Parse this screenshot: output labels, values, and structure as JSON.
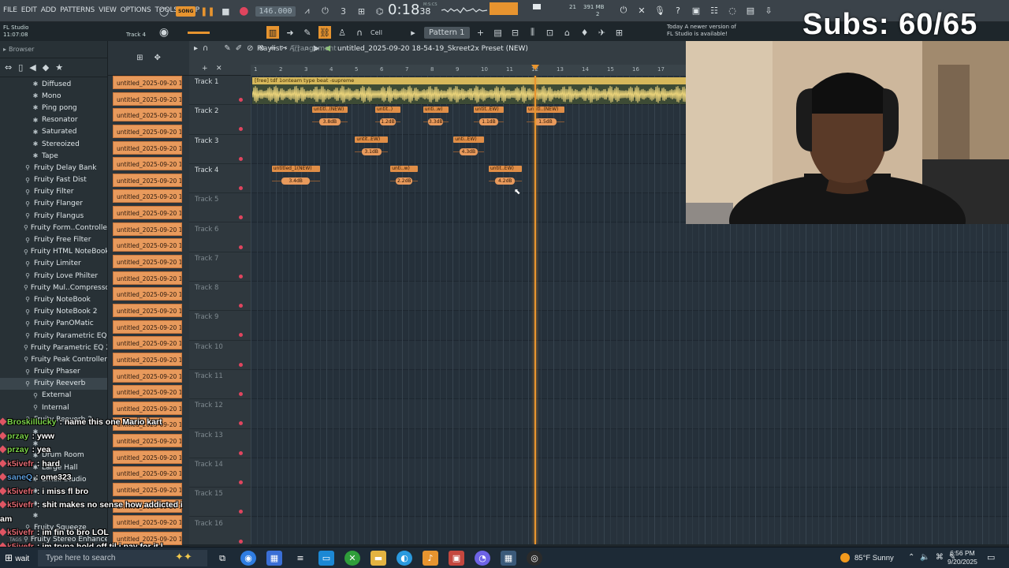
{
  "menu": [
    "FILE",
    "EDIT",
    "ADD",
    "PATTERNS",
    "VIEW",
    "OPTIONS",
    "TOOLS",
    "HELP"
  ],
  "song_mode": "SONG",
  "tempo": "146.000",
  "time": {
    "main": "0:18",
    "sub": "38",
    "label": "M:S:CS"
  },
  "cpu": {
    "memory": "391 MB",
    "voices": "21",
    "polyphony": "2"
  },
  "hint": {
    "title": "FL Studio",
    "time": "11:07:08",
    "target": "Track 4"
  },
  "toolbar2": {
    "snap": "Cell",
    "pattern": "Pattern 1"
  },
  "news": {
    "line1": "Today  A newer version of",
    "line2": "FL Studio is available!"
  },
  "subs": "Subs: 60/65",
  "browser": {
    "title": "Browser",
    "items": [
      {
        "label": "Diffused",
        "icon": "gear",
        "indent": 3
      },
      {
        "label": "Mono",
        "icon": "gear",
        "indent": 3
      },
      {
        "label": "Ping pong",
        "icon": "gear",
        "indent": 3
      },
      {
        "label": "Resonator",
        "icon": "gear",
        "indent": 3
      },
      {
        "label": "Saturated",
        "icon": "gear",
        "indent": 3
      },
      {
        "label": "Stereoized",
        "icon": "gear",
        "indent": 3
      },
      {
        "label": "Tape",
        "icon": "gear",
        "indent": 3
      },
      {
        "label": "Fruity Delay Bank",
        "icon": "plug",
        "indent": 2
      },
      {
        "label": "Fruity Fast Dist",
        "icon": "plug",
        "indent": 2
      },
      {
        "label": "Fruity Filter",
        "icon": "plug",
        "indent": 2
      },
      {
        "label": "Fruity Flanger",
        "icon": "plug",
        "indent": 2
      },
      {
        "label": "Fruity Flangus",
        "icon": "plug",
        "indent": 2
      },
      {
        "label": "Fruity Form..Controller",
        "icon": "plug",
        "indent": 2
      },
      {
        "label": "Fruity Free Filter",
        "icon": "plug",
        "indent": 2
      },
      {
        "label": "Fruity HTML NoteBook",
        "icon": "plug",
        "indent": 2
      },
      {
        "label": "Fruity Limiter",
        "icon": "plug",
        "indent": 2
      },
      {
        "label": "Fruity Love Philter",
        "icon": "plug",
        "indent": 2
      },
      {
        "label": "Fruity Mul..Compressor",
        "icon": "plug",
        "indent": 2
      },
      {
        "label": "Fruity NoteBook",
        "icon": "plug",
        "indent": 2
      },
      {
        "label": "Fruity NoteBook 2",
        "icon": "plug",
        "indent": 2
      },
      {
        "label": "Fruity PanOMatic",
        "icon": "plug",
        "indent": 2
      },
      {
        "label": "Fruity Parametric EQ",
        "icon": "plug",
        "indent": 2
      },
      {
        "label": "Fruity Parametric EQ 2",
        "icon": "plug",
        "indent": 2
      },
      {
        "label": "Fruity Peak Controller",
        "icon": "plug",
        "indent": 2
      },
      {
        "label": "Fruity Phaser",
        "icon": "plug",
        "indent": 2
      },
      {
        "label": "Fruity Reeverb",
        "icon": "plug",
        "indent": 2,
        "selected": true
      },
      {
        "label": "External",
        "icon": "plug",
        "indent": 3
      },
      {
        "label": "Internal",
        "icon": "plug",
        "indent": 3
      },
      {
        "label": "Fruity Reeverb 2",
        "icon": "plug",
        "indent": 2
      },
      {
        "label": "",
        "icon": "gear",
        "indent": 3
      },
      {
        "label": "",
        "icon": "gear",
        "indent": 3
      },
      {
        "label": "Drum Room",
        "icon": "gear",
        "indent": 3
      },
      {
        "label": "Large Hall",
        "icon": "gear",
        "indent": 3
      },
      {
        "label": "Small Studio",
        "icon": "gear",
        "indent": 3
      },
      {
        "label": "",
        "icon": "gear",
        "indent": 3
      },
      {
        "label": "",
        "icon": "gear",
        "indent": 3
      },
      {
        "label": "",
        "icon": "gear",
        "indent": 3
      },
      {
        "label": "Fruity Squeeze",
        "icon": "plug",
        "indent": 2
      },
      {
        "label": "Fruity Stereo Enhancer",
        "icon": "plug",
        "indent": 2
      }
    ],
    "tags": "TAGS"
  },
  "channel_clips": {
    "label": "untitled_2025-09-20 18-",
    "count": 29
  },
  "playlist": {
    "title": "Playlist",
    "subtitle": "Arrangement",
    "pattern_name": "untitled_2025-09-20 18-54-19_Skreet2x Preset (NEW)",
    "ruler": [
      "1",
      "2",
      "3",
      "4",
      "5",
      "6",
      "7",
      "8",
      "9",
      "10",
      "11",
      "12",
      "13",
      "14",
      "15",
      "16",
      "17"
    ],
    "tracks": [
      "Track 1",
      "Track 2",
      "Track 3",
      "Track 4",
      "Track 5",
      "Track 6",
      "Track 7",
      "Track 8",
      "Track 9",
      "Track 10",
      "Track 11",
      "Track 12",
      "Track 13",
      "Track 14",
      "Track 15",
      "Track 16"
    ],
    "main_clip": "[free] tdf 1onteam type beat -supreme",
    "clips": [
      {
        "track": 1,
        "bar": 3.0,
        "width": 1.4,
        "label": "untitl..(NEW)",
        "db": "3.8dB"
      },
      {
        "track": 1,
        "bar": 5.5,
        "width": 1.0,
        "label": "untit..)",
        "db": "1.2dB"
      },
      {
        "track": 1,
        "bar": 7.4,
        "width": 1.0,
        "label": "unti..w)",
        "db": "3.3dB"
      },
      {
        "track": 1,
        "bar": 9.4,
        "width": 1.2,
        "label": "untit..EW)",
        "db": "1.1dB"
      },
      {
        "track": 1,
        "bar": 11.5,
        "width": 1.5,
        "label": "untitl..(NEW)",
        "db": "1.5dB"
      },
      {
        "track": 2,
        "bar": 4.7,
        "width": 1.3,
        "label": "untit..EW)",
        "db": "3.1dB"
      },
      {
        "track": 2,
        "bar": 8.6,
        "width": 1.2,
        "label": "unti..EW)",
        "db": "4.3dB"
      },
      {
        "track": 3,
        "bar": 1.4,
        "width": 1.9,
        "label": "untitled_1(NEW)",
        "db": "3.4dB"
      },
      {
        "track": 3,
        "bar": 6.1,
        "width": 1.1,
        "label": "unti..w)",
        "db": "2.2dB"
      },
      {
        "track": 3,
        "bar": 10.0,
        "width": 1.3,
        "label": "untit..EW)",
        "db": "4.2dB"
      }
    ]
  },
  "chat": [
    {
      "user": "Broskillucky",
      "msg": "name this one Mario kart",
      "color": "#7bd34a"
    },
    {
      "user": "przay",
      "msg": "yww",
      "color": "#7bd34a"
    },
    {
      "user": "przay",
      "msg": "yea",
      "color": "#7bd34a"
    },
    {
      "user": "k5ivefr",
      "msg": "hard",
      "color": "#e36b74"
    },
    {
      "user": "saneQ",
      "msg": "ome323",
      "color": "#5b9bd8"
    },
    {
      "user": "k5ivefr",
      "msg": "i miss fl bro",
      "color": "#e36b74"
    },
    {
      "user": "k5ivefr",
      "msg": "shit makes no sense how addicted i",
      "color": "#e36b74"
    },
    {
      "user": "",
      "msg": "am",
      "color": "#ffffff"
    },
    {
      "user": "k5ivefr",
      "msg": "im fin to bro LOL",
      "color": "#e36b74"
    },
    {
      "user": "k5ivefr",
      "msg": "im tryna hold off til i pay for it l",
      "color": "#e36b74"
    }
  ],
  "taskbar": {
    "search_placeholder": "Type here to search",
    "weather": "85°F  Sunny",
    "time": "6:56 PM",
    "date": "9/20/2025",
    "start": "wait"
  },
  "colors": {
    "accent": "#e9952f",
    "clip": "#e89a5c",
    "record": "#e0455e"
  }
}
